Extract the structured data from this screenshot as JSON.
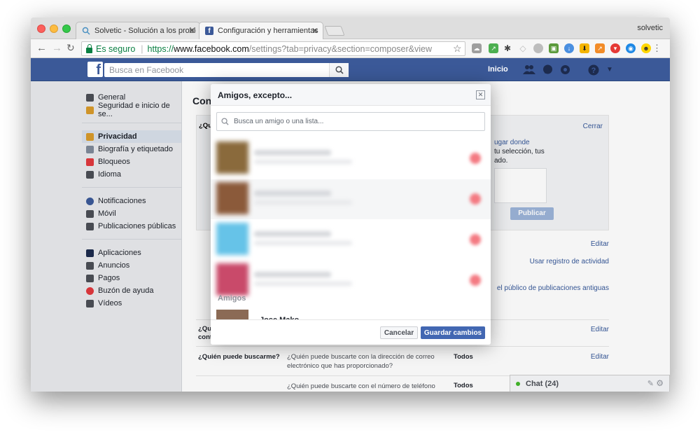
{
  "browser": {
    "tabs": [
      {
        "title": "Solvetic - Solución a los proble",
        "favicon": "solvetic-icon"
      },
      {
        "title": "Configuración y herramientas de",
        "favicon": "facebook-icon"
      }
    ],
    "profile": "solvetic",
    "secure_label": "Es seguro",
    "url_proto": "https://",
    "url_host": "www.facebook.com",
    "url_path": "/settings?tab=privacy&section=composer&view"
  },
  "facebook": {
    "logo": "f",
    "search_placeholder": "Busca en Facebook",
    "home": "Inicio",
    "brand_color": "#3b5998"
  },
  "sidebar": {
    "groups": [
      [
        {
          "label": "General",
          "icon": "gear-icon"
        },
        {
          "label": "Seguridad e inicio de se...",
          "icon": "badge-icon"
        }
      ],
      [
        {
          "label": "Privacidad",
          "icon": "lock-icon",
          "active": true
        },
        {
          "label": "Biografía y etiquetado",
          "icon": "timeline-icon"
        },
        {
          "label": "Bloqueos",
          "icon": "block-icon"
        },
        {
          "label": "Idioma",
          "icon": "language-icon"
        }
      ],
      [
        {
          "label": "Notificaciones",
          "icon": "globe-icon"
        },
        {
          "label": "Móvil",
          "icon": "mobile-icon"
        },
        {
          "label": "Publicaciones públicas",
          "icon": "rss-icon"
        }
      ],
      [
        {
          "label": "Aplicaciones",
          "icon": "apps-icon"
        },
        {
          "label": "Anuncios",
          "icon": "ads-icon"
        },
        {
          "label": "Pagos",
          "icon": "card-icon"
        },
        {
          "label": "Buzón de ayuda",
          "icon": "help-icon"
        },
        {
          "label": "Vídeos",
          "icon": "film-icon"
        }
      ]
    ]
  },
  "main": {
    "title_partial": "Conf",
    "panel": {
      "q_partial": "¿Qui",
      "close": "Cerrar",
      "text1": "ugar donde",
      "text2": "tu selección, tus",
      "text3": "ado.",
      "publish": "Publicar"
    },
    "edit1": "Editar",
    "activity_log": "Usar registro de actividad",
    "old_posts": "el público de publicaciones antiguas",
    "row_partial_q1": "¿Qui",
    "row_partial_q2": "cont",
    "edit2": "Editar",
    "search_row": {
      "question": "¿Quién puede buscarme?",
      "desc": "¿Quién puede buscarte con la dirección de correo electrónico que has proporcionado?",
      "value": "Todos",
      "edit": "Editar"
    },
    "phone_row": {
      "desc": "¿Quién puede buscarte con el número de teléfono",
      "value": "Todos"
    }
  },
  "chat": {
    "label": "Chat (24)"
  },
  "modal": {
    "title": "Amigos, excepto...",
    "search_placeholder": "Busca un amigo o una lista...",
    "section_label": "Amigos",
    "partial_name": "Jose Mako",
    "cancel": "Cancelar",
    "save": "Guardar cambios",
    "excluded_friends": [
      {
        "pic_color": "#8a6a3c"
      },
      {
        "pic_color": "#8b5a3a"
      },
      {
        "pic_color": "#66c3e8"
      },
      {
        "pic_color": "#c94a6a"
      }
    ]
  }
}
